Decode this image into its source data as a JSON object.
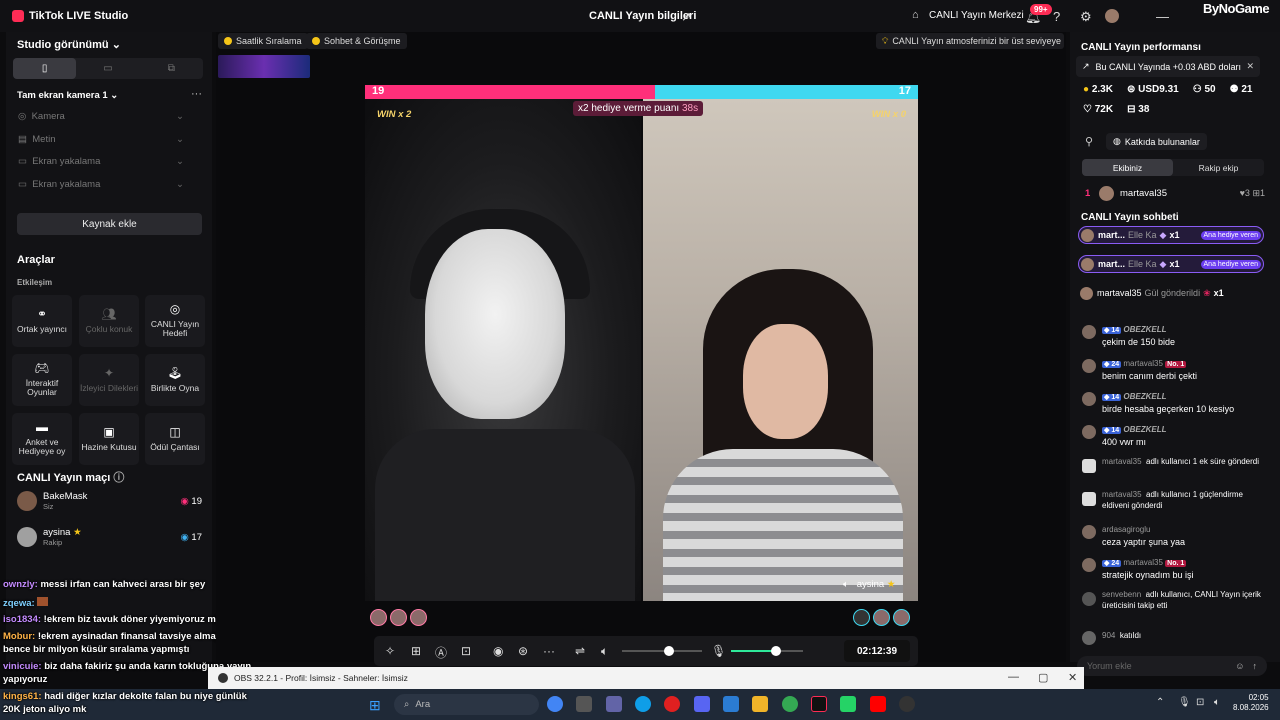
{
  "app": {
    "title": "TikTok LIVE Studio",
    "live_info": "CANLI Yayın bilgileri",
    "live_center": "CANLI Yayın Merkezi",
    "notif_badge": "99+",
    "watermark": "ByNoGame"
  },
  "left": {
    "studio_view": "Studio görünümü",
    "source_group": "Tam ekran kamera 1",
    "sources": [
      "Kamera",
      "Metin",
      "Ekran yakalama",
      "Ekran yakalama"
    ],
    "add_source": "Kaynak ekle",
    "tools_title": "Araçlar",
    "engagement": "Etkileşim",
    "tools": [
      "Ortak yayıncı",
      "Çoklu konuk",
      "CANLI Yayın Hedefi",
      "İnteraktif Oyunlar",
      "İzleyici Dilekleri",
      "Birlikte Oyna",
      "Anket ve Hediyeye oy",
      "Hazine Kutusu",
      "Ödül Çantası"
    ],
    "match_title": "CANLI Yayın maçı",
    "match": [
      {
        "name": "BakeMask",
        "sub": "Siz",
        "score": "19"
      },
      {
        "name": "aysina",
        "sub": "Rakip",
        "score": "17"
      }
    ]
  },
  "overlay_chat": [
    {
      "user": "ownzly:",
      "text": "messi irfan can kahveci arası bir şey"
    },
    {
      "user": "zqewa:",
      "text": ""
    },
    {
      "user": "iso1834:",
      "text": "!ekrem biz tavuk döner yiyemiyoruz mk"
    },
    {
      "user": "Mobur:",
      "text": "!ekrem aysinadan finansal tavsiye almayalım"
    },
    {
      "user": "",
      "text": "bence bir milyon küsür sıralama yapmıştı"
    },
    {
      "user": "vinicuie:",
      "text": "biz daha fakiriz şu anda karın tokluğuna yayın"
    },
    {
      "user": "",
      "text": "yapıyoruz"
    },
    {
      "user": "kings61:",
      "text": "hadi diğer kızlar dekolte falan bu niye günlük"
    },
    {
      "user": "",
      "text": "20K jeton aliyo mk"
    }
  ],
  "stage": {
    "pill1": "Saatlik Sıralama",
    "pill2": "Sohbet & Görüşme",
    "tip": "CANLI Yayın atmosferinizi bir üst seviyeye ...",
    "score_left": "19",
    "score_right": "17",
    "multiplier": "x2 hediye verme puanı",
    "multiplier_time": "38s",
    "win_left": "WIN x 2",
    "win_right": "WIN x 0",
    "opponent_label": "aysina",
    "timer": "02:12:39"
  },
  "right": {
    "performance": "CANLI Yayın performansı",
    "earning": "Bu CANLI Yayında +0.03 ABD doları",
    "stats": [
      "2.3K",
      "USD9.31",
      "50",
      "21"
    ],
    "stats2": [
      "72K",
      "38"
    ],
    "contributors": "Katkıda bulunanlar",
    "tab_us": "Ekibiniz",
    "tab_them": "Rakip ekip",
    "rank": {
      "pos": "1",
      "name": "martaval35",
      "a": "3",
      "b": "1"
    },
    "chat_title": "CANLI Yayın sohbeti",
    "gifts": [
      {
        "user": "mart...",
        "gift": "Elle Ka",
        "count": "x1",
        "tag": "Ana hediye veren"
      },
      {
        "user": "mart...",
        "gift": "Elle Ka",
        "count": "x1",
        "tag": "Ana hediye veren"
      }
    ],
    "rose": {
      "user": "martaval35",
      "text": "Gül gönderildi",
      "count": "x1"
    },
    "messages": [
      {
        "lv": "14",
        "user": "OBEZKELL",
        "text": "çekim de 150 bide"
      },
      {
        "lv": "24",
        "user": "martaval35",
        "text": "benim canım derbi çekti",
        "no": "No. 1"
      },
      {
        "lv": "14",
        "user": "OBEZKELL",
        "text": "birde hesaba geçerken 10 kesiyo"
      },
      {
        "lv": "14",
        "user": "OBEZKELL",
        "text": "400 vwr mı"
      },
      {
        "lv": "",
        "user": "martaval35",
        "text": "adlı kullanıcı 1 ek süre gönderdi"
      },
      {
        "lv": "",
        "user": "martaval35",
        "text": "adlı kullanıcı 1 güçlendirme eldiveni gönderdi"
      },
      {
        "lv": "",
        "user": "ardasagiroglu",
        "text": "ceza yaptır şuna yaa"
      },
      {
        "lv": "24",
        "user": "martaval35",
        "text": "stratejik oynadım bu işi",
        "no": "No. 1"
      },
      {
        "lv": "",
        "user": "senvebenn",
        "text": "adlı kullanıcı, CANLI Yayın içerik üreticisini takip etti"
      },
      {
        "lv": "",
        "user": "904",
        "text": "katıldı"
      }
    ],
    "comment_placeholder": "Yorum ekle"
  },
  "obs": {
    "title": "OBS 32.2.1 - Profil: İsimsiz - Sahneler: İsimsiz"
  },
  "taskbar": {
    "search": "Ara",
    "time": "02:05",
    "date": "8.08.2026"
  }
}
